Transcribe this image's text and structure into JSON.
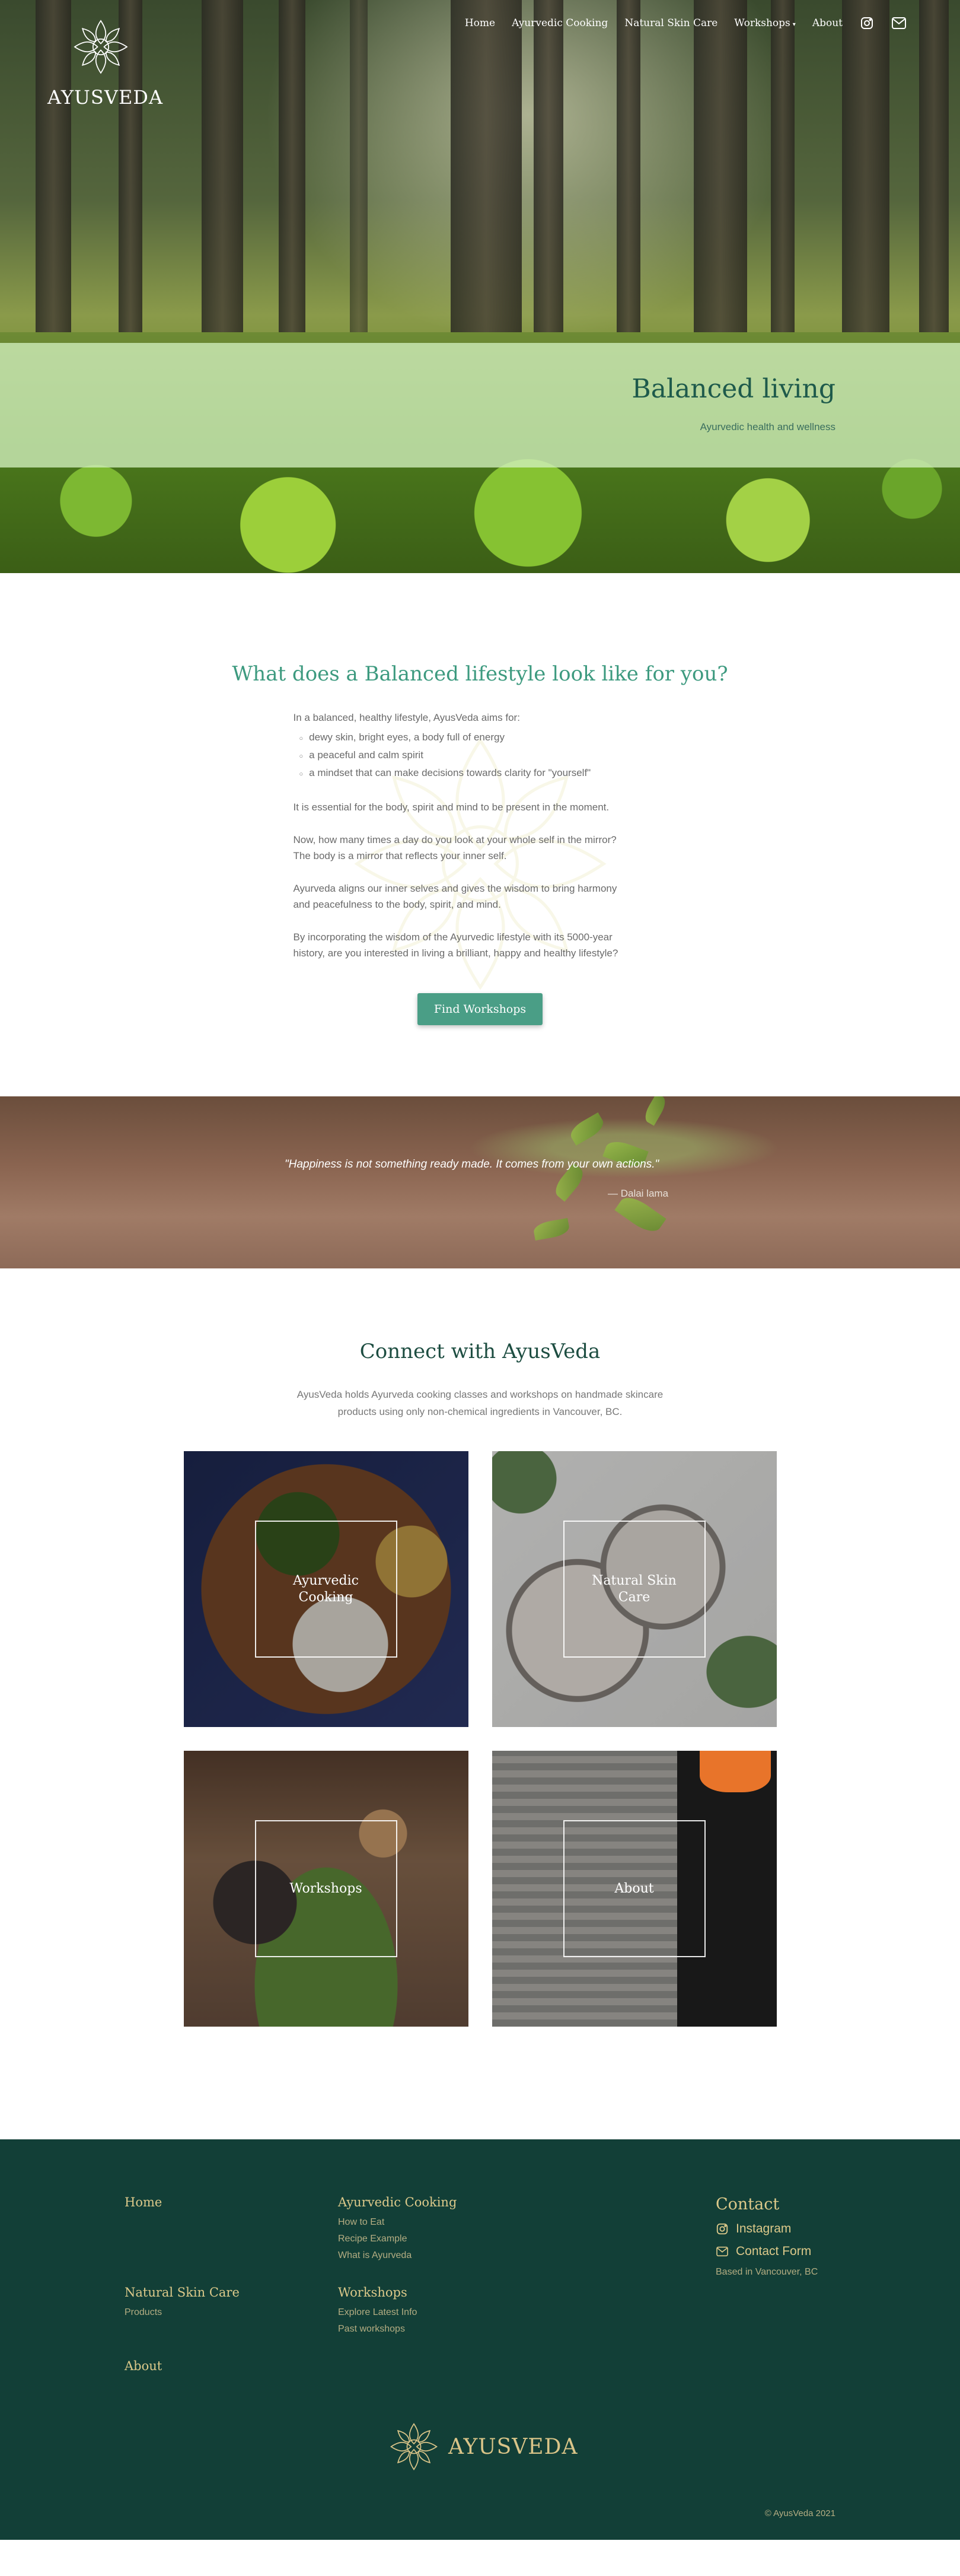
{
  "brand": {
    "name": "AYUSVEDA",
    "logo_icon": "lotus-mandala-icon"
  },
  "nav": {
    "items": [
      "Home",
      "Ayurvedic Cooking",
      "Natural Skin Care",
      "Workshops",
      "About"
    ],
    "workshops_dropdown_icon": "chevron-down-icon",
    "social_icons": [
      "instagram-icon",
      "mail-icon"
    ]
  },
  "hero": {
    "title": "Balanced living",
    "subtitle": "Ayurvedic health and wellness"
  },
  "intro": {
    "heading": "What does a Balanced lifestyle look like for you?",
    "lead": "In a balanced, healthy lifestyle, AyusVeda aims for:",
    "bullets": [
      "dewy skin, bright eyes, a body full of energy",
      "a peaceful and calm spirit",
      "a mindset that can make decisions towards clarity for \"yourself\""
    ],
    "p1": "It is essential for the body, spirit and mind to be present in the moment.",
    "p2a": "Now, how many times a day do you look at your whole self in the mirror?",
    "p2b": "The body is a mirror that reflects your inner self.",
    "p3a": "Ayurveda aligns our inner selves and gives the wisdom to bring harmony",
    "p3b": "and peacefulness to the body, spirit, and mind.",
    "p4a": "By incorporating the wisdom of the Ayurvedic lifestyle with its 5000-year",
    "p4b": "history, are you interested in living a brilliant, happy and healthy lifestyle?",
    "button": "Find Workshops"
  },
  "quote": {
    "text": "\"Happiness is not something ready made. It comes from your own actions.\"",
    "author": "— Dalai lama"
  },
  "connect": {
    "heading": "Connect with AyusVeda",
    "desc_line1": "AyusVeda holds Ayurveda cooking classes and workshops on handmade skincare",
    "desc_line2": "products using only non-chemical ingredients in Vancouver, BC.",
    "tiles": [
      {
        "line1": "Ayurvedic",
        "line2": "Cooking"
      },
      {
        "line1": "Natural Skin",
        "line2": "Care"
      },
      {
        "line1": "Workshops",
        "line2": ""
      },
      {
        "line1": "About",
        "line2": ""
      }
    ]
  },
  "footer": {
    "home": "Home",
    "cooking": {
      "title": "Ayurvedic Cooking",
      "links": [
        "How to Eat",
        "Recipe Example",
        "What is Ayurveda"
      ]
    },
    "skincare": {
      "title": "Natural Skin Care",
      "links": [
        "Products"
      ]
    },
    "workshops": {
      "title": "Workshops",
      "links": [
        "Explore Latest Info",
        "Past workshops"
      ]
    },
    "about": "About",
    "contact": {
      "title": "Contact",
      "instagram": "Instagram",
      "form": "Contact Form",
      "location": "Based in Vancouver, BC"
    },
    "logo_text": "AYUSVEDA",
    "copyright": "© AyusVeda 2021"
  },
  "colors": {
    "accent": "#4a9e86",
    "footer_bg": "#123f37",
    "footer_gold": "#dcc98a",
    "heading_green": "#3d9a7f"
  }
}
